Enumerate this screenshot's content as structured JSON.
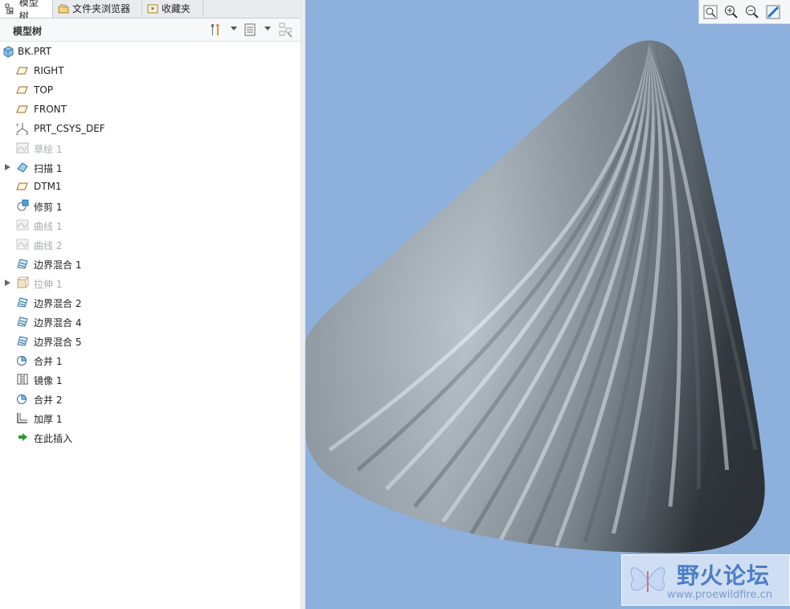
{
  "tabs": [
    {
      "label": "模型树",
      "icon": "model-tree-icon"
    },
    {
      "label": "文件夹浏览器",
      "icon": "folder-browser-icon"
    },
    {
      "label": "收藏夹",
      "icon": "favorites-icon"
    }
  ],
  "tree_header": {
    "title": "模型树"
  },
  "tree": {
    "root": {
      "label": "BK.PRT",
      "icon": "part-icon"
    },
    "items": [
      {
        "label": "RIGHT",
        "icon": "datum-plane-icon",
        "dim": false,
        "expandable": false
      },
      {
        "label": "TOP",
        "icon": "datum-plane-icon",
        "dim": false,
        "expandable": false
      },
      {
        "label": "FRONT",
        "icon": "datum-plane-icon",
        "dim": false,
        "expandable": false
      },
      {
        "label": "PRT_CSYS_DEF",
        "icon": "csys-icon",
        "dim": false,
        "expandable": false
      },
      {
        "label": "草绘 1",
        "icon": "sketch-icon",
        "dim": true,
        "expandable": false
      },
      {
        "label": "扫描 1",
        "icon": "sweep-icon",
        "dim": false,
        "expandable": true
      },
      {
        "label": "DTM1",
        "icon": "datum-plane-icon",
        "dim": false,
        "expandable": false
      },
      {
        "label": "修剪 1",
        "icon": "trim-icon",
        "dim": false,
        "expandable": false
      },
      {
        "label": "曲线 1",
        "icon": "curve-icon",
        "dim": true,
        "expandable": false
      },
      {
        "label": "曲线 2",
        "icon": "curve-icon",
        "dim": true,
        "expandable": false
      },
      {
        "label": "边界混合 1",
        "icon": "boundary-blend-icon",
        "dim": false,
        "expandable": false
      },
      {
        "label": "拉伸 1",
        "icon": "extrude-icon",
        "dim": true,
        "expandable": true
      },
      {
        "label": "边界混合 2",
        "icon": "boundary-blend-icon",
        "dim": false,
        "expandable": false
      },
      {
        "label": "边界混合 4",
        "icon": "boundary-blend-icon",
        "dim": false,
        "expandable": false
      },
      {
        "label": "边界混合 5",
        "icon": "boundary-blend-icon",
        "dim": false,
        "expandable": false
      },
      {
        "label": "合并 1",
        "icon": "merge-icon",
        "dim": false,
        "expandable": false
      },
      {
        "label": "镜像 1",
        "icon": "mirror-icon",
        "dim": false,
        "expandable": false
      },
      {
        "label": "合并 2",
        "icon": "merge-icon",
        "dim": false,
        "expandable": false
      },
      {
        "label": "加厚 1",
        "icon": "thicken-icon",
        "dim": false,
        "expandable": false
      },
      {
        "label": "在此插入",
        "icon": "insert-here-arrow-icon",
        "dim": false,
        "expandable": false
      }
    ]
  },
  "view_toolbar": {
    "buttons": [
      "zoom-refit-icon",
      "zoom-in-icon",
      "zoom-out-icon",
      "repaint-icon"
    ]
  },
  "watermark": {
    "title": "野火论坛",
    "url": "www.proewildfire.cn"
  },
  "colors": {
    "viewport_bg": "#8db0dd",
    "model_gray": "#8a98a3",
    "accent_blue": "#2a6fc7"
  }
}
